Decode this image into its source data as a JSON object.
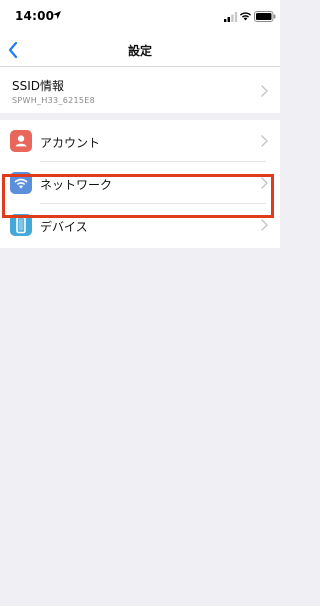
{
  "status_bar": {
    "time": "14:00",
    "location_icon": "location-arrow-icon",
    "signal_icon": "cellular-signal-icon",
    "wifi_icon": "wifi-icon",
    "battery_icon": "battery-icon"
  },
  "nav": {
    "title": "設定",
    "back_icon": "chevron-left-icon"
  },
  "ssid": {
    "title": "SSID情報",
    "value": "SPWH_H33_6215E8"
  },
  "menu": {
    "items": [
      {
        "label": "アカウント",
        "icon": "account-icon",
        "icon_color": "#e8675a"
      },
      {
        "label": "ネットワーク",
        "icon": "wifi-network-icon",
        "icon_color": "#5b8fdc"
      },
      {
        "label": "デバイス",
        "icon": "device-icon",
        "icon_color": "#43a7d8"
      }
    ]
  },
  "colors": {
    "accent": "#1e7bf6",
    "highlight": "#e03a1f",
    "background": "#efeff4"
  }
}
